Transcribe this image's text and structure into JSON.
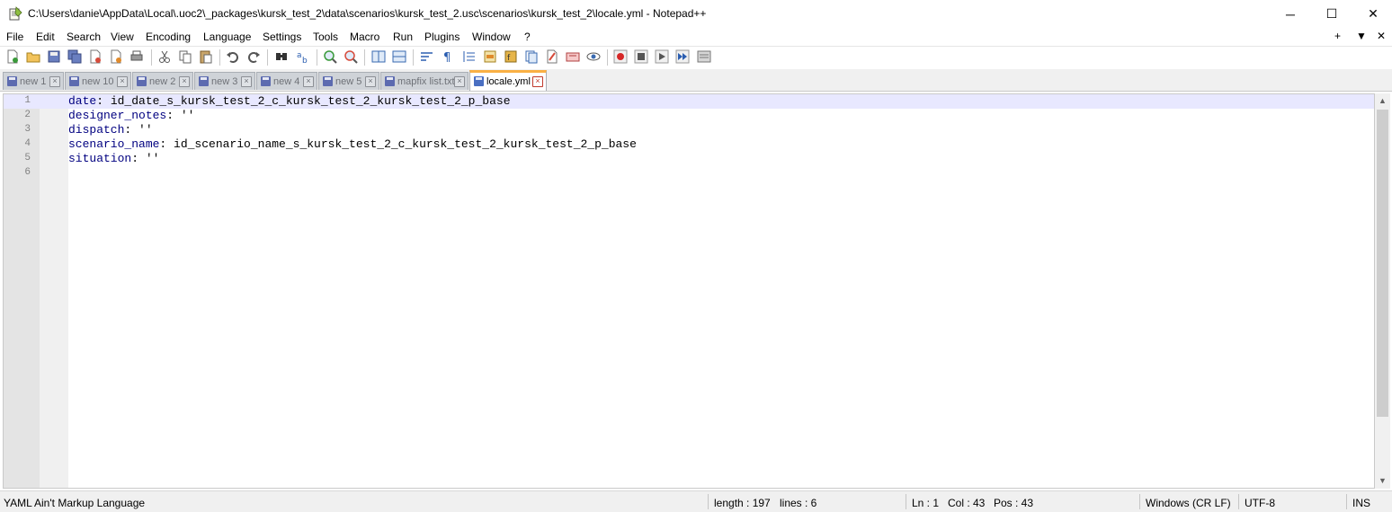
{
  "window": {
    "title": "C:\\Users\\danie\\AppData\\Local\\.uoc2\\_packages\\kursk_test_2\\data\\scenarios\\kursk_test_2.usc\\scenarios\\kursk_test_2\\locale.yml - Notepad++",
    "minimize": "─",
    "maximize": "☐",
    "close": "✕"
  },
  "menu": {
    "items": [
      "File",
      "Edit",
      "Search",
      "View",
      "Encoding",
      "Language",
      "Settings",
      "Tools",
      "Macro",
      "Run",
      "Plugins",
      "Window",
      "?"
    ],
    "right_plus": "+",
    "right_down": "▼",
    "right_close": "✕"
  },
  "toolbar": {
    "icons": [
      "new-file-icon",
      "open-file-icon",
      "save-icon",
      "save-all-icon",
      "close-icon",
      "close-all-icon",
      "print-icon",
      "cut-icon",
      "copy-icon",
      "paste-icon",
      "undo-icon",
      "redo-icon",
      "find-icon",
      "replace-icon",
      "zoom-in-icon",
      "zoom-out-icon",
      "sync-vertical-icon",
      "sync-horizontal-icon",
      "word-wrap-icon",
      "show-all-chars-icon",
      "indent-guide-icon",
      "document-map-icon",
      "function-list-icon",
      "folder-workspace-icon",
      "document-list-icon",
      "monitoring-icon",
      "record-macro-icon",
      "stop-macro-icon",
      "play-macro-icon",
      "run-macro-multiple-icon",
      "save-macro-icon"
    ]
  },
  "tabs": [
    {
      "label": "new 1",
      "active": false
    },
    {
      "label": "new 10",
      "active": false
    },
    {
      "label": "new 2",
      "active": false
    },
    {
      "label": "new 3",
      "active": false
    },
    {
      "label": "new 4",
      "active": false
    },
    {
      "label": "new 5",
      "active": false
    },
    {
      "label": "mapfix list.txt",
      "active": false
    },
    {
      "label": "locale.yml",
      "active": true
    }
  ],
  "editor": {
    "lines": [
      {
        "num": "1",
        "key": "date",
        "rest": ": id_date_s_kursk_test_2_c_kursk_test_2_kursk_test_2_p_base"
      },
      {
        "num": "2",
        "key": "designer_notes",
        "rest": ": ''"
      },
      {
        "num": "3",
        "key": "dispatch",
        "rest": ": ''"
      },
      {
        "num": "4",
        "key": "scenario_name",
        "rest": ": id_scenario_name_s_kursk_test_2_c_kursk_test_2_kursk_test_2_p_base"
      },
      {
        "num": "5",
        "key": "situation",
        "rest": ": ''"
      },
      {
        "num": "6",
        "key": "",
        "rest": ""
      }
    ],
    "current_line": 1
  },
  "status": {
    "language": "YAML Ain't Markup Language",
    "length": "length : 197",
    "lines": "lines : 6",
    "ln": "Ln : 1",
    "col": "Col : 43",
    "pos": "Pos : 43",
    "eol": "Windows (CR LF)",
    "encoding": "UTF-8",
    "mode": "INS"
  },
  "colors": {
    "accent_tab": "#fab044",
    "current_line": "#e8e8ff",
    "yaml_key": "#000080"
  }
}
